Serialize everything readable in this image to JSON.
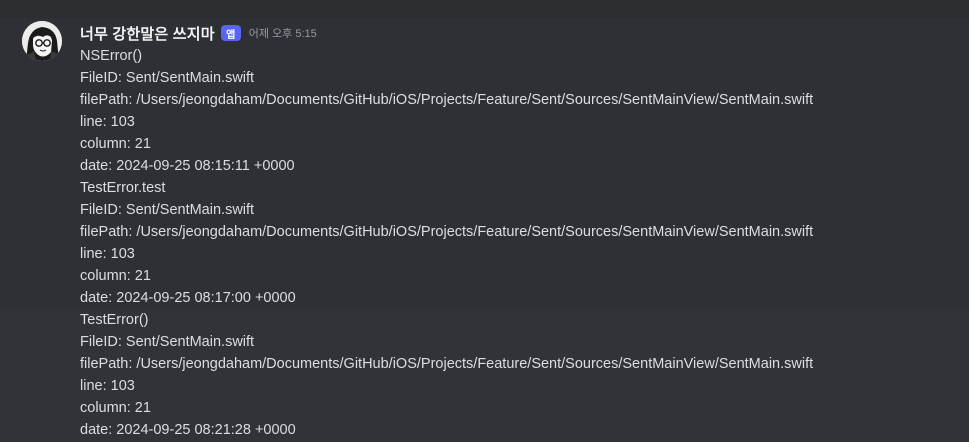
{
  "message": {
    "username": "너무 강한말은 쓰지마",
    "app_badge": "앱",
    "timestamp": "어제 오후 5:15",
    "blocks": [
      {
        "lines": [
          "NSError()",
          "FileID: Sent/SentMain.swift",
          "filePath: /Users/jeongdaham/Documents/GitHub/iOS/Projects/Feature/Sent/Sources/SentMainView/SentMain.swift",
          "line: 103",
          "column: 21",
          "date: 2024-09-25 08:15:11 +0000"
        ]
      },
      {
        "lines": [
          "TestError.test",
          "FileID: Sent/SentMain.swift",
          "filePath: /Users/jeongdaham/Documents/GitHub/iOS/Projects/Feature/Sent/Sources/SentMainView/SentMain.swift",
          "line: 103",
          "column: 21",
          "date: 2024-09-25 08:17:00 +0000"
        ]
      },
      {
        "lines": [
          "TestError()",
          "FileID: Sent/SentMain.swift",
          "filePath: /Users/jeongdaham/Documents/GitHub/iOS/Projects/Feature/Sent/Sources/SentMainView/SentMain.swift",
          "line: 103",
          "column: 21",
          "date: 2024-09-25 08:21:28 +0000"
        ]
      }
    ]
  },
  "icons": {
    "avatar": "avatar-image",
    "badge": "app-badge"
  },
  "colors": {
    "background": "#313338",
    "hover": "#2e3035",
    "text": "#dbdee1",
    "username": "#f2f3f5",
    "timestamp": "#949ba4",
    "badge": "#5865f2"
  }
}
